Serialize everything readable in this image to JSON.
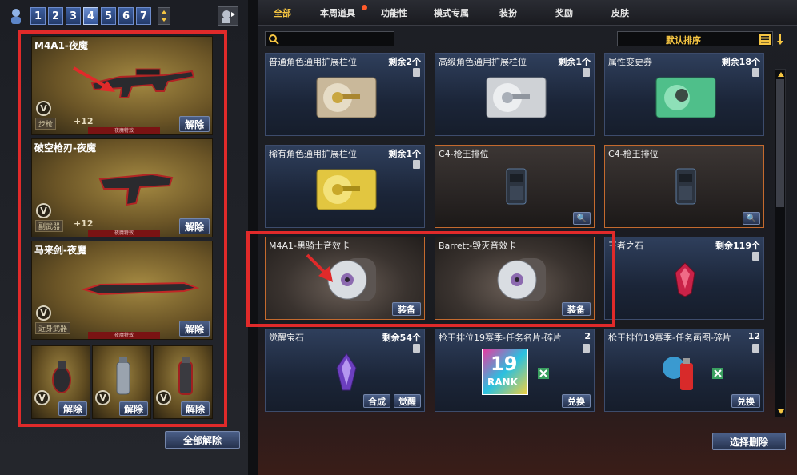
{
  "left": {
    "page_numbers": [
      "1",
      "2",
      "3",
      "4",
      "5",
      "6",
      "7"
    ],
    "active_page": "4",
    "slots": [
      {
        "title": "M4A1-夜魔",
        "tag": "步枪",
        "plus": "+12",
        "band": "夜魔特效",
        "button": "解除"
      },
      {
        "title": "破空枪刃-夜魔",
        "tag": "副武器",
        "plus": "+12",
        "band": "夜魔特效",
        "button": "解除"
      },
      {
        "title": "马来剑-夜魔",
        "tag": "近身武器",
        "plus": "",
        "band": "夜魔特效",
        "button": "解除"
      }
    ],
    "small_slots": [
      {
        "button": "解除"
      },
      {
        "button": "解除"
      },
      {
        "button": "解除"
      }
    ],
    "remove_all": "全部解除",
    "v_label": "V"
  },
  "right": {
    "tabs": [
      "全部",
      "本周道具",
      "功能性",
      "模式专属",
      "装扮",
      "奖励",
      "皮肤"
    ],
    "active_tab": "全部",
    "search_placeholder": "",
    "sort_label": "默认排序",
    "items": [
      {
        "name": "普通角色通用扩展栏位",
        "count": "剩余2个",
        "button": ""
      },
      {
        "name": "高级角色通用扩展栏位",
        "count": "剩余1个",
        "button": ""
      },
      {
        "name": "属性变更券",
        "count": "剩余18个",
        "button": ""
      },
      {
        "name": "稀有角色通用扩展栏位",
        "count": "剩余1个",
        "button": ""
      },
      {
        "name": "C4-枪王排位",
        "count": "",
        "button": ""
      },
      {
        "name": "C4-枪王排位",
        "count": "",
        "button": ""
      },
      {
        "name": "M4A1-黑骑士音效卡",
        "count": "",
        "button": "装备"
      },
      {
        "name": "Barrett-毁灭音效卡",
        "count": "",
        "button": "装备"
      },
      {
        "name": "王者之石",
        "count": "剩余119个",
        "button": ""
      },
      {
        "name": "觉醒宝石",
        "count": "剩余54个",
        "button": "觉醒",
        "button2": "合成"
      },
      {
        "name": "枪王排位19赛季-任务名片-碎片",
        "count": "2",
        "button": "兑换"
      },
      {
        "name": "枪王排位19赛季-任务画图-碎片",
        "count": "12",
        "button": "兑换"
      }
    ],
    "rank_number": "19",
    "rank_text": "RANK",
    "select_delete": "选择删除"
  },
  "colors": {
    "highlight_red": "#e02a2a",
    "accent_gold": "#f5c542",
    "button_blue": "#34466b"
  }
}
